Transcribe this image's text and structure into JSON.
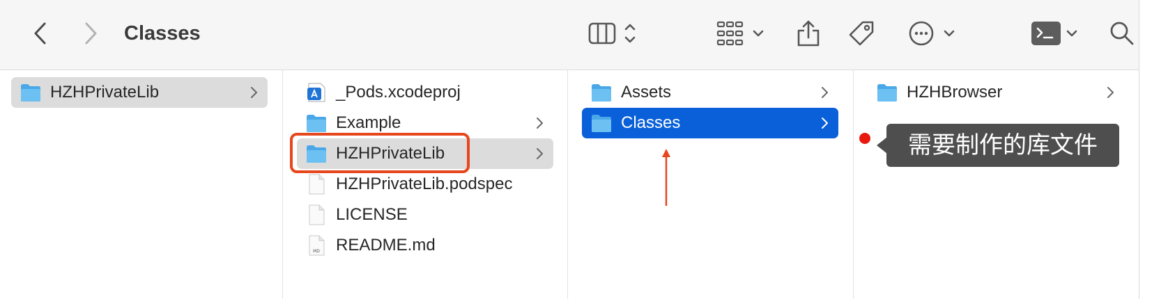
{
  "window": {
    "title": "Classes"
  },
  "toolbar": {
    "back_icon": "chevron-left-icon",
    "forward_icon": "chevron-right-icon",
    "view_icon": "columns-view-icon",
    "group_icon": "grid-group-icon",
    "share_icon": "share-icon",
    "tag_icon": "tag-icon",
    "more_icon": "ellipsis-circle-icon",
    "terminal_icon": "terminal-icon",
    "search_icon": "search-icon"
  },
  "columns": [
    {
      "items": [
        {
          "label": "HZHPrivateLib",
          "icon": "folder-icon",
          "has_children": true,
          "state": "selected-inactive"
        }
      ]
    },
    {
      "items": [
        {
          "label": "_Pods.xcodeproj",
          "icon": "xcodeproj-icon",
          "has_children": false,
          "state": ""
        },
        {
          "label": "Example",
          "icon": "folder-icon",
          "has_children": true,
          "state": ""
        },
        {
          "label": "HZHPrivateLib",
          "icon": "folder-icon",
          "has_children": true,
          "state": "selected-inactive"
        },
        {
          "label": "HZHPrivateLib.podspec",
          "icon": "document-icon",
          "has_children": false,
          "state": ""
        },
        {
          "label": "LICENSE",
          "icon": "document-icon",
          "has_children": false,
          "state": ""
        },
        {
          "label": "README.md",
          "icon": "markdown-document-icon",
          "has_children": false,
          "state": ""
        }
      ]
    },
    {
      "items": [
        {
          "label": "Assets",
          "icon": "folder-icon",
          "has_children": true,
          "state": ""
        },
        {
          "label": "Classes",
          "icon": "folder-icon",
          "has_children": true,
          "state": "selected-active"
        }
      ]
    },
    {
      "items": [
        {
          "label": "HZHBrowser",
          "icon": "folder-icon",
          "has_children": true,
          "state": ""
        }
      ]
    }
  ],
  "annotation": {
    "tooltip_text": "需要制作的库文件",
    "highlight_color": "#e8461c",
    "dot_color": "#e8190f"
  },
  "colors": {
    "selection_blue": "#0a60d8",
    "selection_gray": "#dcdcdc",
    "folder_blue": "#5fb4ee"
  },
  "md_badge": "MD"
}
